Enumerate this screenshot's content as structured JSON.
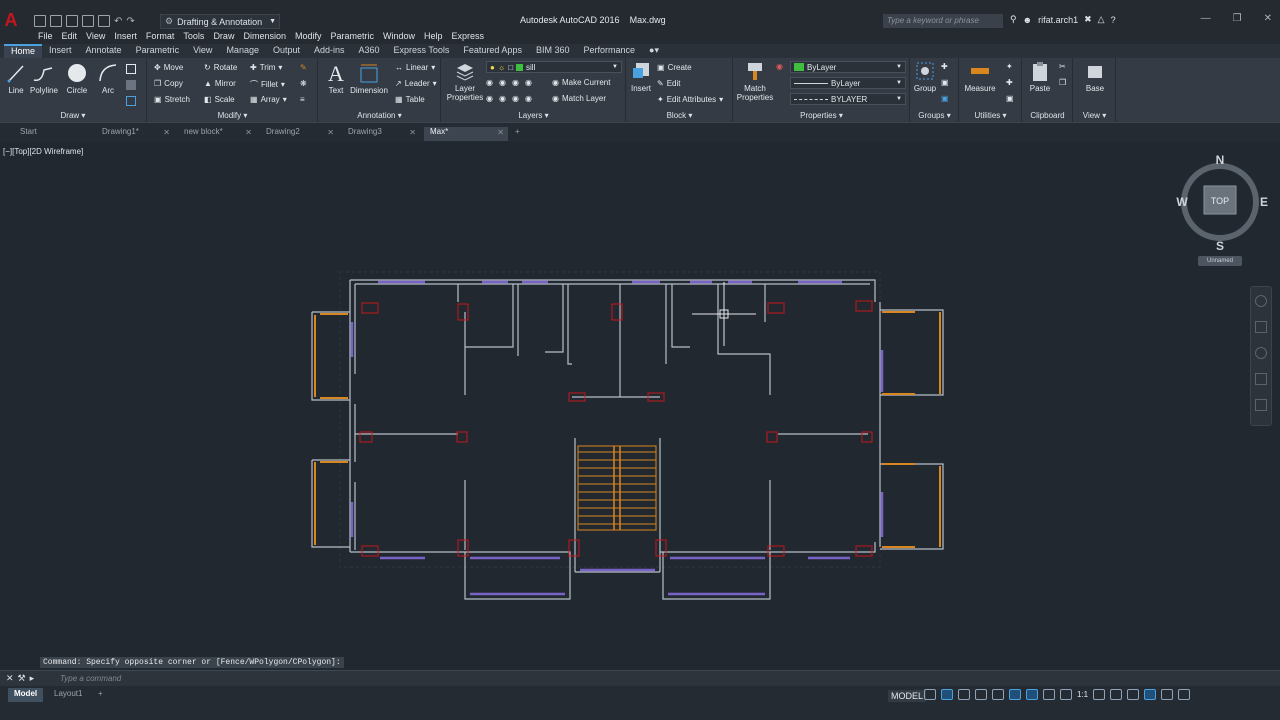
{
  "app": {
    "title": "Autodesk AutoCAD 2016    Max.dwg",
    "app_button": "A",
    "workspace": "Drafting & Annotation",
    "search_placeholder": "Type a keyword or phrase",
    "user": "rifat.arch1"
  },
  "menus": [
    "File",
    "Edit",
    "View",
    "Insert",
    "Format",
    "Tools",
    "Draw",
    "Dimension",
    "Modify",
    "Parametric",
    "Window",
    "Help",
    "Express"
  ],
  "ribbon_tabs": [
    "Home",
    "Insert",
    "Annotate",
    "Parametric",
    "View",
    "Manage",
    "Output",
    "Add-ins",
    "A360",
    "Express Tools",
    "Featured Apps",
    "BIM 360",
    "Performance"
  ],
  "panels": {
    "draw": {
      "title": "Draw",
      "line": "Line",
      "polyline": "Polyline",
      "circle": "Circle",
      "arc": "Arc"
    },
    "modify": {
      "title": "Modify",
      "move": "Move",
      "rotate": "Rotate",
      "trim": "Trim",
      "copy": "Copy",
      "mirror": "Mirror",
      "fillet": "Fillet",
      "stretch": "Stretch",
      "scale": "Scale",
      "array": "Array"
    },
    "annotation": {
      "title": "Annotation",
      "text": "Text",
      "dimension": "Dimension",
      "linear": "Linear",
      "leader": "Leader",
      "table": "Table"
    },
    "layers": {
      "title": "Layers",
      "layer_properties": "Layer Properties",
      "current_layer": "sill",
      "make_current": "Make Current",
      "match_layer": "Match Layer"
    },
    "block": {
      "title": "Block",
      "insert": "Insert",
      "create": "Create",
      "edit": "Edit",
      "edit_attributes": "Edit Attributes"
    },
    "properties": {
      "title": "Properties",
      "match_properties": "Match Properties",
      "color": "ByLayer",
      "linetype": "ByLayer",
      "lineweight": "BYLAYER"
    },
    "groups": {
      "title": "Groups",
      "group": "Group"
    },
    "utilities": {
      "title": "Utilities",
      "measure": "Measure"
    },
    "clipboard": {
      "title": "Clipboard",
      "paste": "Paste"
    },
    "view": {
      "title": "View",
      "base": "Base"
    }
  },
  "doc_tabs": [
    {
      "label": "Start"
    },
    {
      "label": "Drawing1*"
    },
    {
      "label": "new block*"
    },
    {
      "label": "Drawing2"
    },
    {
      "label": "Drawing3"
    },
    {
      "label": "Max*"
    }
  ],
  "viewport": {
    "label": "[−][Top][2D Wireframe]",
    "cube": {
      "n": "N",
      "s": "S",
      "e": "E",
      "w": "W",
      "face": "TOP",
      "ucs": "Unnamed"
    }
  },
  "command": {
    "history": "Command: Specify opposite corner or [Fence/WPolygon/CPolygon]:",
    "placeholder": "Type a command"
  },
  "layout_tabs": [
    "Model",
    "Layout1"
  ],
  "status": {
    "space": "MODEL",
    "scale": "1:1"
  },
  "colors": {
    "wall": "#b7c0c9",
    "column": "#c8141c",
    "window_blue": "#7a63c7",
    "window_orange": "#d9861f",
    "stair": "#d9861f",
    "background": "#212830"
  }
}
